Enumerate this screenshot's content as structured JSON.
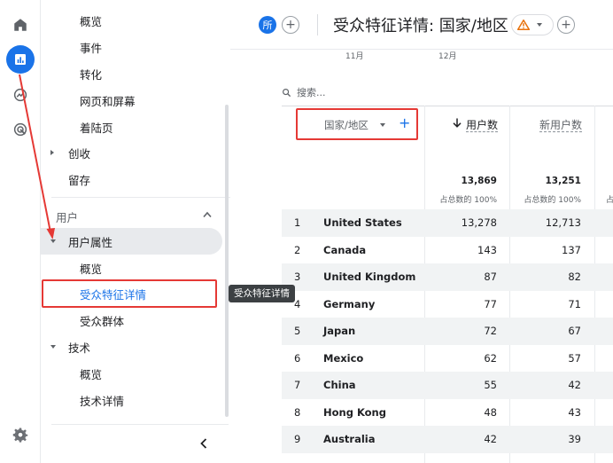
{
  "rail": {
    "items": [
      {
        "icon": "home-icon"
      },
      {
        "icon": "reports-icon",
        "active": true
      },
      {
        "icon": "explore-icon"
      },
      {
        "icon": "advertising-icon"
      }
    ],
    "settings_icon": "gear-icon"
  },
  "sidebar": {
    "items_top": [
      "概览",
      "事件",
      "转化",
      "网页和屏幕",
      "着陆页"
    ],
    "monetization": "创收",
    "retention": "留存",
    "section_user": "用户",
    "user_attributes": "用户属性",
    "ua_overview": "概览",
    "ua_details": "受众特征详情",
    "audiences": "受众群体",
    "tech": "技术",
    "tech_overview": "概览",
    "tech_details": "技术详情"
  },
  "tooltip": "受众特征详情",
  "header": {
    "compare_chip": "所",
    "title": "受众特征详情: 国家/地区"
  },
  "chart_months": [
    "11月",
    "12月"
  ],
  "search": {
    "placeholder": "搜索..."
  },
  "table": {
    "dimension": "国家/地区",
    "metrics": [
      "用户数",
      "新用户数"
    ],
    "totals": [
      "13,869",
      "13,251"
    ],
    "totals_pct": [
      "占总数的 100%",
      "占总数的 100%"
    ],
    "edge_fragment": "占",
    "rows": [
      {
        "idx": "1",
        "country": "United States",
        "users": "13,278",
        "new_users": "12,713"
      },
      {
        "idx": "2",
        "country": "Canada",
        "users": "143",
        "new_users": "137"
      },
      {
        "idx": "3",
        "country": "United Kingdom",
        "users": "87",
        "new_users": "82"
      },
      {
        "idx": "4",
        "country": "Germany",
        "users": "77",
        "new_users": "71"
      },
      {
        "idx": "5",
        "country": "Japan",
        "users": "72",
        "new_users": "67"
      },
      {
        "idx": "6",
        "country": "Mexico",
        "users": "62",
        "new_users": "57"
      },
      {
        "idx": "7",
        "country": "China",
        "users": "55",
        "new_users": "42"
      },
      {
        "idx": "8",
        "country": "Hong Kong",
        "users": "48",
        "new_users": "43"
      },
      {
        "idx": "9",
        "country": "Australia",
        "users": "42",
        "new_users": "39"
      }
    ]
  },
  "colors": {
    "accent": "#1a73e8",
    "highlight": "#e53935",
    "warning": "#e8710a"
  }
}
